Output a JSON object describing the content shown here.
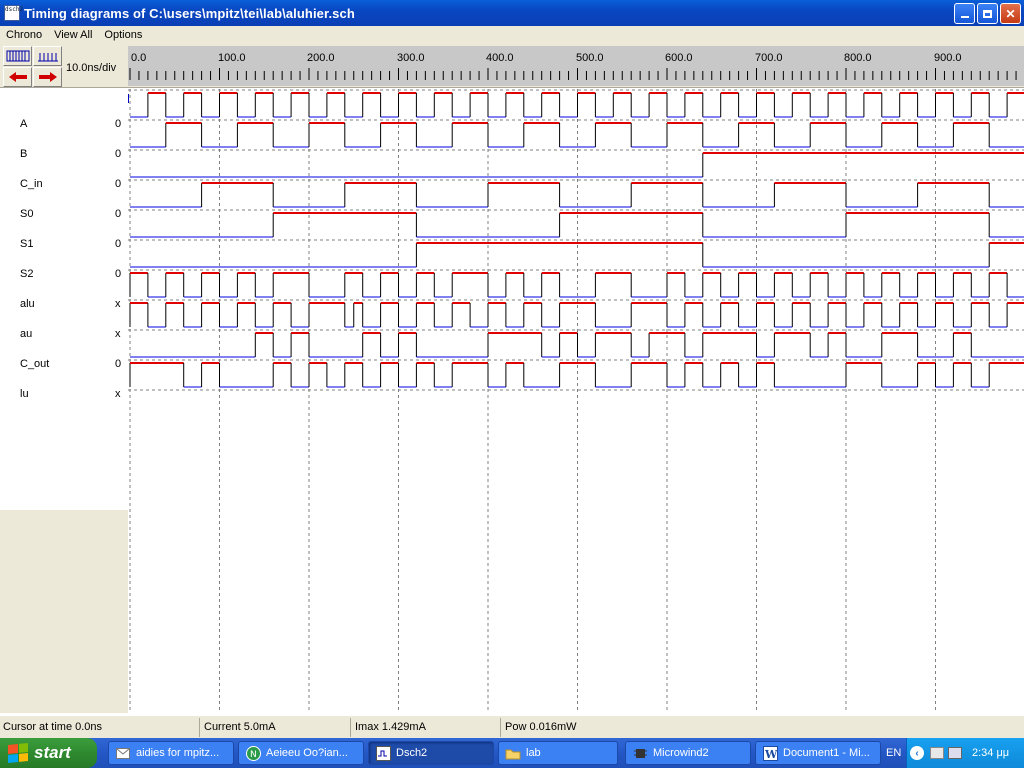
{
  "window": {
    "title": "Timing diagrams of C:\\users\\mpitz\\tei\\lab\\aluhier.sch",
    "icon_text": "dsch2"
  },
  "menu": [
    "Chrono",
    "View All",
    "Options"
  ],
  "toolbar": {
    "scale_label": "10.0ns/div"
  },
  "ruler": {
    "labels": [
      "0.0",
      "100.0",
      "200.0",
      "300.0",
      "400.0",
      "500.0",
      "600.0",
      "700.0",
      "800.0",
      "900.0"
    ]
  },
  "signals": [
    {
      "name": "A",
      "value": "0"
    },
    {
      "name": "B",
      "value": "0"
    },
    {
      "name": "C_in",
      "value": "0"
    },
    {
      "name": "S0",
      "value": "0"
    },
    {
      "name": "S1",
      "value": "0"
    },
    {
      "name": "S2",
      "value": "0"
    },
    {
      "name": "alu",
      "value": "x"
    },
    {
      "name": "au",
      "value": "x"
    },
    {
      "name": "C_out",
      "value": "0"
    },
    {
      "name": "lu",
      "value": "x"
    }
  ],
  "colors": {
    "high": "#e00000",
    "low": "#0000e0",
    "grid": "#808080"
  },
  "status": {
    "cursor": "Cursor at time  0.0ns",
    "current": "Current  5.0mA",
    "imax": "Imax 1.429mA",
    "pow": "Pow 0.016mW"
  },
  "taskbar": {
    "start": "start",
    "tasks": [
      {
        "label": "aidies for mpitz...",
        "icon": "mail-icon"
      },
      {
        "label": "Aeieeu Oo?ian...",
        "icon": "browser-icon"
      },
      {
        "label": "Dsch2",
        "icon": "dsch-icon",
        "active": true
      },
      {
        "label": "lab",
        "icon": "folder-icon"
      },
      {
        "label": "Microwind2",
        "icon": "chip-icon"
      },
      {
        "label": "Document1 - Mi...",
        "icon": "word-icon"
      }
    ],
    "lang": "EN",
    "clock": "2:34 μμ"
  }
}
